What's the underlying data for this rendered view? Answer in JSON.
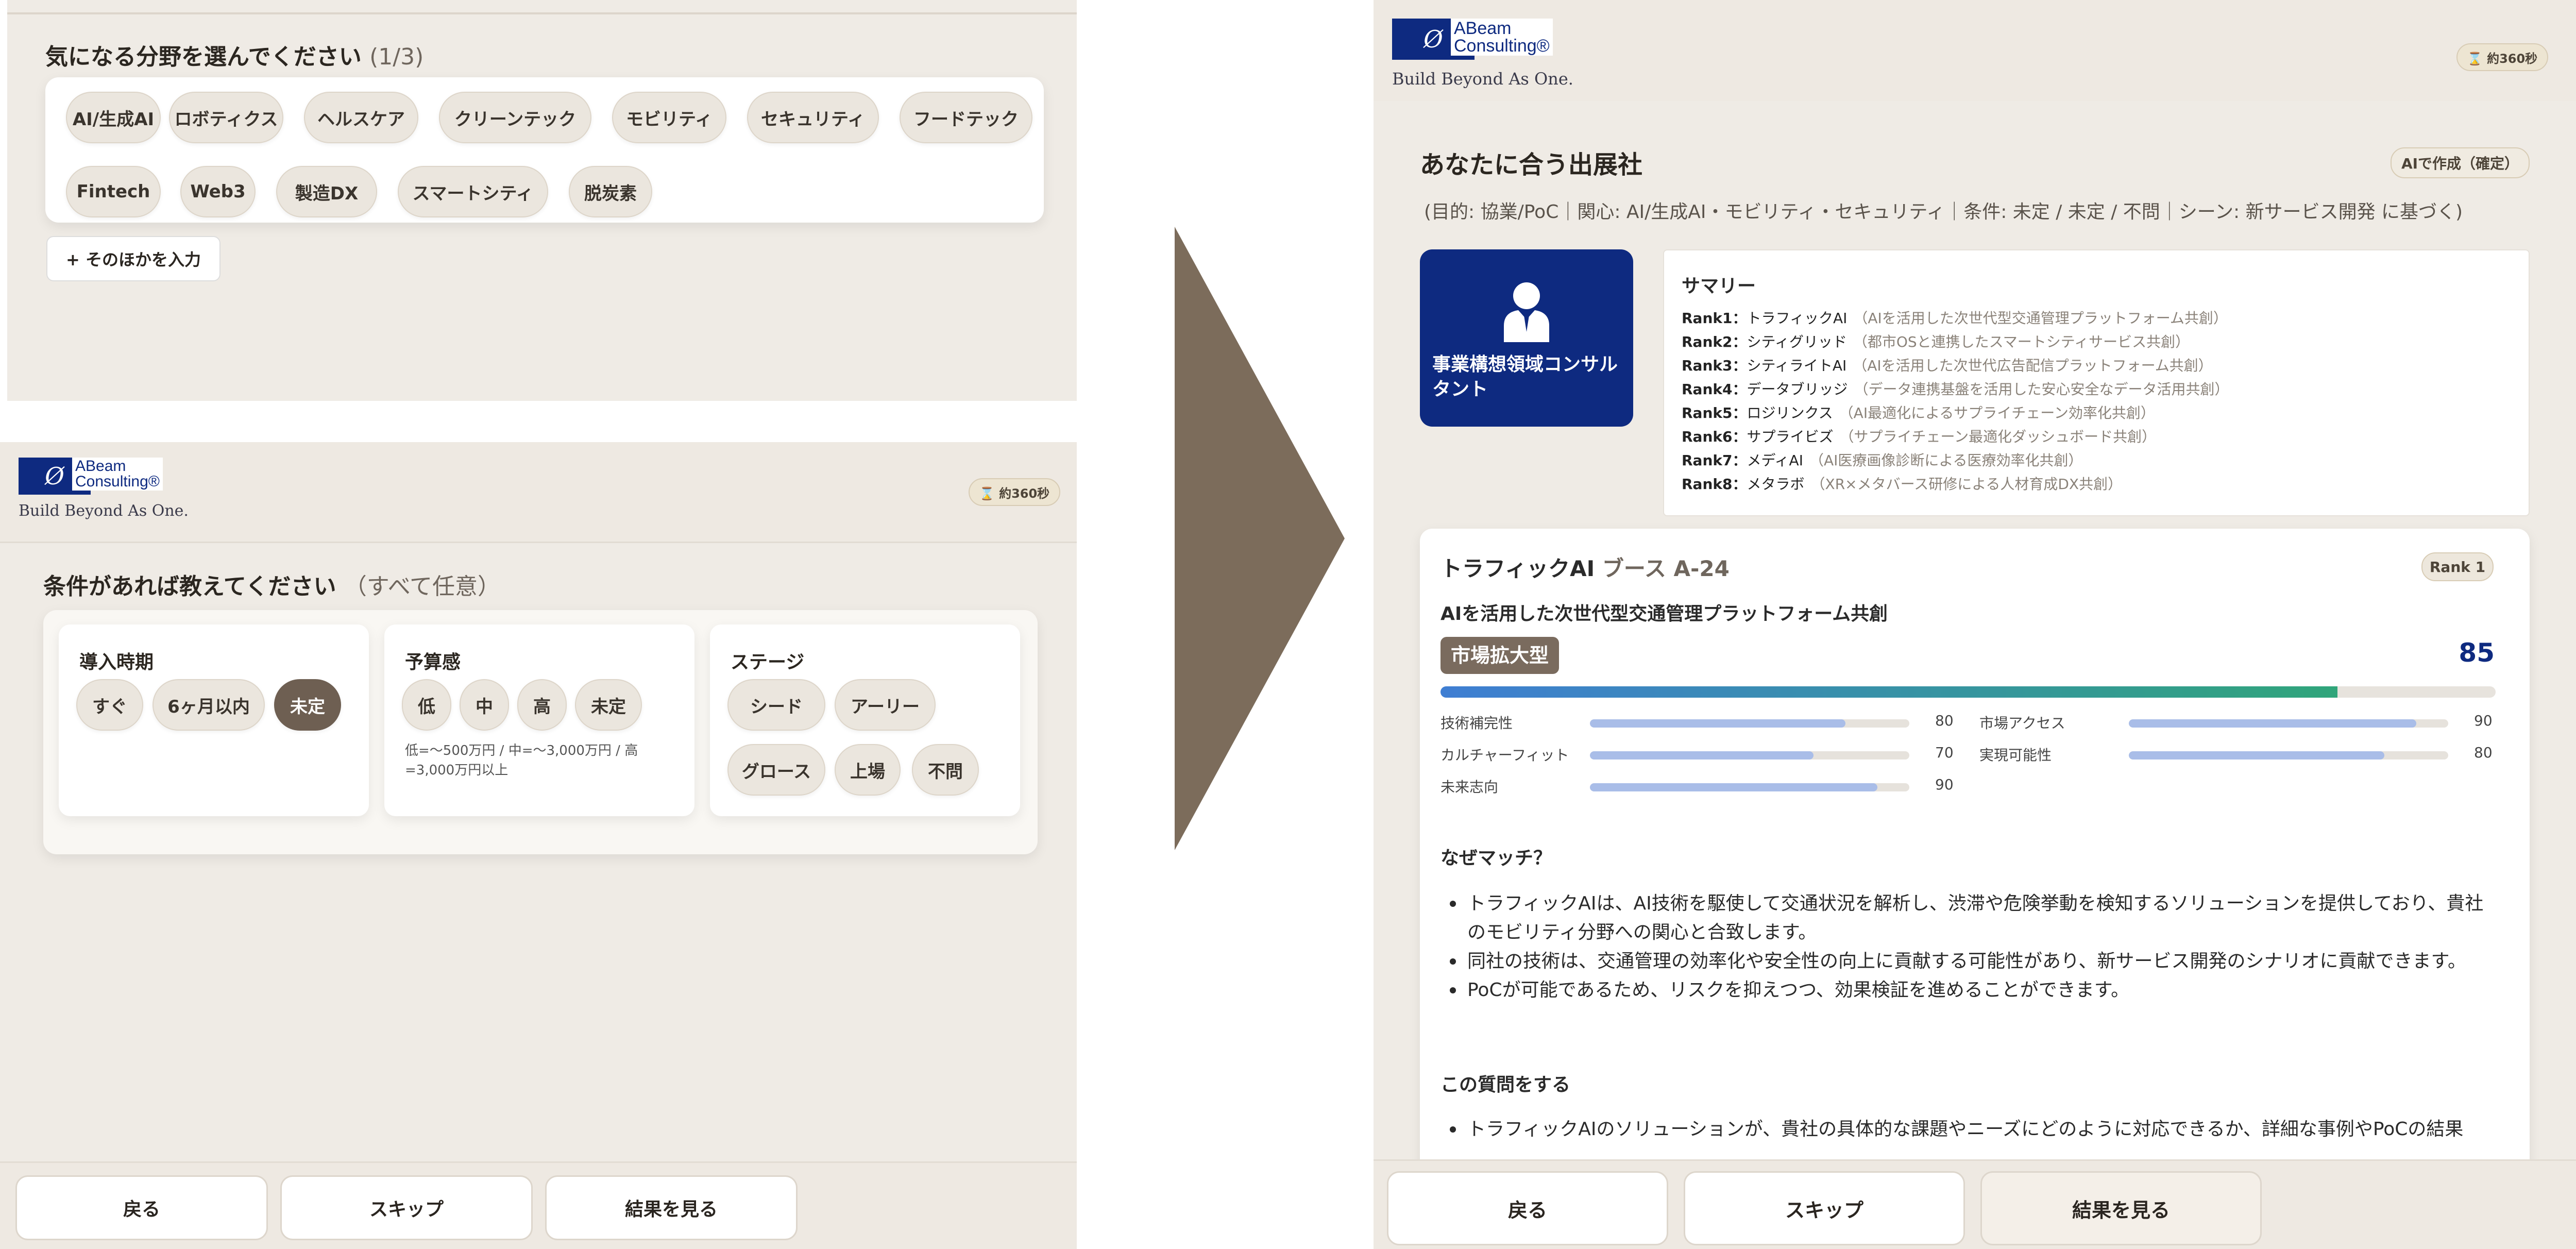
{
  "screen1": {
    "title": "気になる分野を選んでください",
    "step": "(1/3)",
    "fields": [
      "AI/生成AI",
      "ロボティクス",
      "ヘルスケア",
      "クリーンテック",
      "モビリティ",
      "セキュリティ",
      "フードテック",
      "Fintech",
      "Web3",
      "製造DX",
      "スマートシティ",
      "脱炭素"
    ],
    "other_button": "+ そのほかを入力"
  },
  "header": {
    "logo_mark": "Ø",
    "logo_line1": "ABeam",
    "logo_line2": "Consulting®",
    "tagline": "Build Beyond As One.",
    "timer": "⌛ 約360秒"
  },
  "screen2": {
    "title": "条件があれば教えてください",
    "subtitle": "（すべて任意）",
    "timing": {
      "label": "導入時期",
      "options": [
        "すぐ",
        "6ヶ月以内",
        "未定"
      ],
      "selected": "未定"
    },
    "budget": {
      "label": "予算感",
      "options": [
        "低",
        "中",
        "高",
        "未定"
      ],
      "note": "低=〜500万円 / 中=〜3,000万円 / 高=3,000万円以上"
    },
    "stage": {
      "label": "ステージ",
      "options": [
        "シード",
        "アーリー",
        "グロース",
        "上場",
        "不問"
      ]
    }
  },
  "footer": {
    "back": "戻る",
    "skip": "スキップ",
    "results": "結果を見る"
  },
  "results": {
    "title": "あなたに合う出展社",
    "badge": "AIで作成（確定）",
    "conditions": "(目的: 協業/PoC｜関心: AI/生成AI・モビリティ・セキュリティ｜条件: 未定 / 未定 / 不問｜シーン: 新サービス開発 に基づく)",
    "persona_label": "事業構想領域コンサルタント",
    "summary_title": "サマリー",
    "ranks": [
      {
        "rank": "Rank1：",
        "name": "トラフィックAI",
        "desc": "（AIを活用した次世代型交通管理プラットフォーム共創）"
      },
      {
        "rank": "Rank2：",
        "name": "シティグリッド",
        "desc": "（都市OSと連携したスマートシティサービス共創）"
      },
      {
        "rank": "Rank3：",
        "name": "シティライトAI",
        "desc": "（AIを活用した次世代広告配信プラットフォーム共創）"
      },
      {
        "rank": "Rank4：",
        "name": "データブリッジ",
        "desc": "（データ連携基盤を活用した安心安全なデータ活用共創）"
      },
      {
        "rank": "Rank5：",
        "name": "ロジリンクス",
        "desc": "（AI最適化によるサプライチェーン効率化共創）"
      },
      {
        "rank": "Rank6：",
        "name": "サプライビズ",
        "desc": "（サプライチェーン最適化ダッシュボード共創）"
      },
      {
        "rank": "Rank7：",
        "name": "メディAI",
        "desc": "（AI医療画像診断による医療効率化共創）"
      },
      {
        "rank": "Rank8：",
        "name": "メタラボ",
        "desc": "（XR×メタバース研修による人材育成DX共創）"
      }
    ],
    "company": {
      "name": "トラフィックAI",
      "booth": "ブース A-24",
      "rank_badge": "Rank 1",
      "tagline": "AIを活用した次世代型交通管理プラットフォーム共創",
      "type_badge": "市場拡大型",
      "score": "85",
      "score_fraction": 0.85,
      "metrics": [
        {
          "label": "技術補完性",
          "value": "80",
          "fraction": 0.8
        },
        {
          "label": "市場アクセス",
          "value": "90",
          "fraction": 0.9
        },
        {
          "label": "カルチャーフィット",
          "value": "70",
          "fraction": 0.7
        },
        {
          "label": "実現可能性",
          "value": "80",
          "fraction": 0.8
        },
        {
          "label": "未来志向",
          "value": "90",
          "fraction": 0.9
        }
      ],
      "why_title": "なぜマッチ？",
      "why": [
        "トラフィックAIは、AI技術を駆使して交通状況を解析し、渋滞や危険挙動を検知するソリューションを提供しており、貴社のモビリティ分野への関心と合致します。",
        "同社の技術は、交通管理の効率化や安全性の向上に貢献する可能性があり、新サービス開発のシナリオに貢献できます。",
        "PoCが可能であるため、リスクを抑えつつ、効果検証を進めることができます。"
      ],
      "question_title": "この質問をする",
      "questions": [
        "トラフィックAIのソリューションが、貴社の具体的な課題やニーズにどのように対応できるか、詳細な事例やPoCの結果"
      ]
    }
  },
  "colors": {
    "arrow": "#7c6c5b",
    "navy": "#0e2a80",
    "chip_selected": "#6e5f52",
    "score": "#0e2a80"
  }
}
